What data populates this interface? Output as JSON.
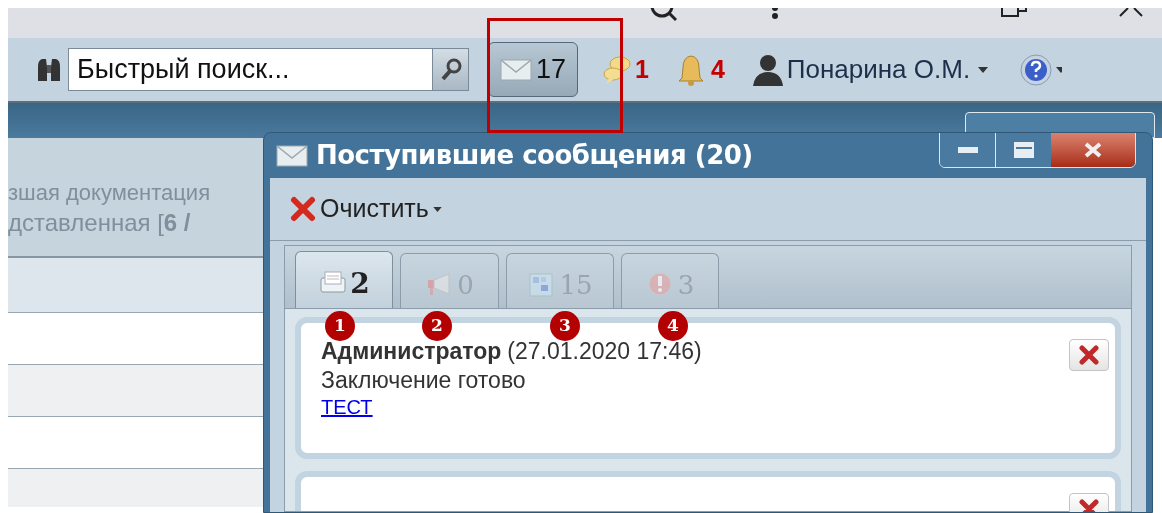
{
  "toolbar": {
    "search": {
      "placeholder": "Быстрый поиск..."
    },
    "mail_count": "17",
    "chat_count": "1",
    "alerts_count": "4",
    "user": "Понарина О.М."
  },
  "background": {
    "lines": [
      "зшая документация",
      "дставленная [**6 /**"
    ]
  },
  "dialog": {
    "title": "Поступившие сообщения (20)",
    "clear_button": "Очистить",
    "tabs": [
      {
        "kind": "messages",
        "count": "2",
        "selected": true
      },
      {
        "kind": "announcements",
        "count": "0",
        "selected": false
      },
      {
        "kind": "tasks",
        "count": "15",
        "selected": false
      },
      {
        "kind": "errors",
        "count": "3",
        "selected": false
      }
    ],
    "messages": [
      {
        "author": "Администратор",
        "time": "(27.01.2020 17:46)",
        "text": "Заключение готово",
        "link": "ТЕСТ"
      }
    ],
    "more_messages_below": true
  },
  "callouts": [
    "1",
    "2",
    "3",
    "4"
  ]
}
